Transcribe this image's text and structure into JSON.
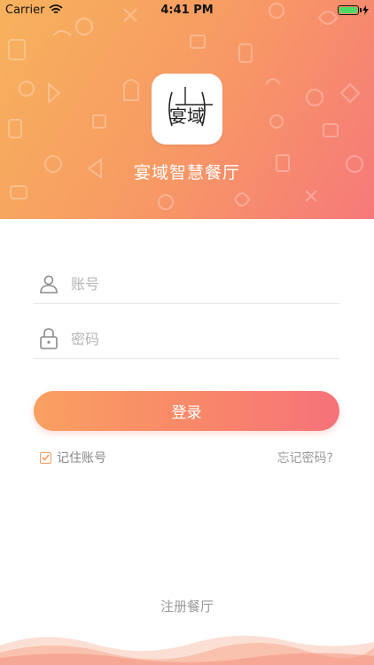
{
  "status_bar": {
    "carrier": "Carrier",
    "time": "4:41 PM"
  },
  "header": {
    "app_name": "宴域智慧餐厅",
    "logo_text": "宴域"
  },
  "login_form": {
    "account_placeholder": "账号",
    "password_placeholder": "密码",
    "login_label": "登录",
    "remember_label": "记住账号",
    "remember_checked": true,
    "forgot_label": "忘记密码?"
  },
  "footer": {
    "register_label": "注册餐厅"
  },
  "colors": {
    "header_gradient_start": "#f7b25c",
    "header_gradient_end": "#f6797a",
    "accent": "#f79a64"
  },
  "icons": [
    "wifi-icon",
    "battery-icon",
    "user-icon",
    "lock-icon",
    "checkmark-icon"
  ]
}
